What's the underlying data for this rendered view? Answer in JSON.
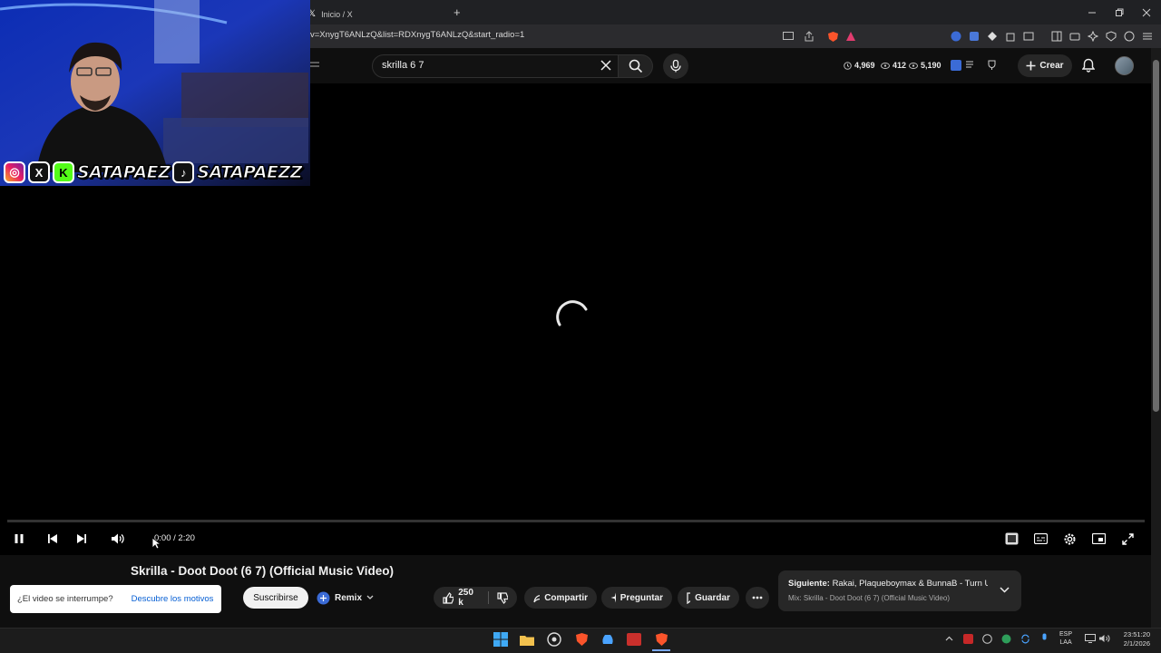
{
  "browser": {
    "tab_title": "Inicio / X",
    "url": "v=XnygT6ANLzQ&list=RDXnygT6ANLzQ&start_radio=1",
    "new_tab": "+"
  },
  "header": {
    "search_value": "skrilla 6 7",
    "stats": {
      "clock": "4,969",
      "views1": "412",
      "views2": "5,190"
    },
    "create_label": "Crear"
  },
  "overlay": {
    "handle_kick": "SATAPAEZ",
    "handle_tiktok": "SATAPAEZZ"
  },
  "player": {
    "time": "0:00 / 2:20",
    "state": "loading",
    "progress": 0
  },
  "video": {
    "title": "Skrilla - Doot Doot (6 7) (Official Music Video)",
    "subscribe_label": "Suscribirse",
    "remix_label": "Remix",
    "likes": "250 k",
    "share_label": "Compartir",
    "ask_label": "Preguntar",
    "save_label": "Guardar"
  },
  "notice": {
    "question": "¿El video se interrumpe?",
    "link": "Descubre los motivos"
  },
  "up_next": {
    "label": "Siguiente:",
    "title": "Rakai, Plaqueboymax & BunnaB - Turn U...",
    "mix": "Mix: Skrilla - Doot Doot (6 7) (Official Music Video)"
  },
  "taskbar": {
    "lang1": "ESP",
    "lang2": "LAA",
    "time": "23:51:20",
    "date": "2/1/2026"
  },
  "colors": {
    "accent": "#065fd4",
    "brave": "#fb542b",
    "dark": "#0f0f0f"
  }
}
